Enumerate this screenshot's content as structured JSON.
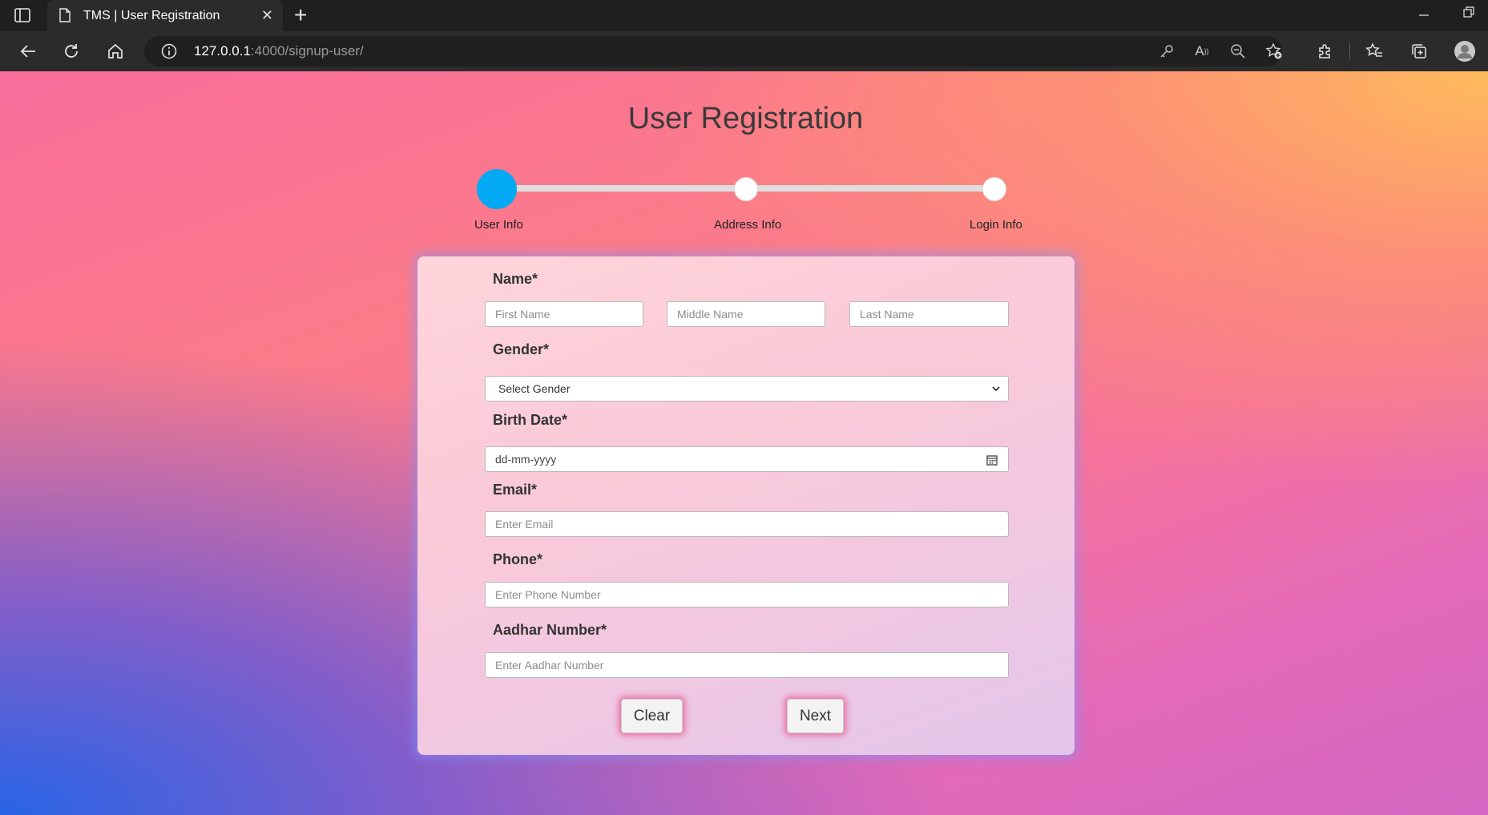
{
  "browser": {
    "tab_title": "TMS | User Registration",
    "url_host": "127.0.0.1",
    "url_rest": ":4000/signup-user/"
  },
  "page": {
    "title": "User Registration"
  },
  "stepper": {
    "steps": [
      {
        "label": "User Info",
        "state": "active"
      },
      {
        "label": "Address Info",
        "state": "pending"
      },
      {
        "label": "Login Info",
        "state": "pending"
      }
    ],
    "active_color": "#03a9f4"
  },
  "form": {
    "name_label": "Name*",
    "first_name_placeholder": "First Name",
    "middle_name_placeholder": "Middle Name",
    "last_name_placeholder": "Last Name",
    "gender_label": "Gender*",
    "gender_selected": "Select Gender",
    "birth_label": "Birth Date*",
    "birth_value": "dd-mm-yyyy",
    "email_label": "Email*",
    "email_placeholder": "Enter Email",
    "phone_label": "Phone*",
    "phone_placeholder": "Enter Phone Number",
    "aadhar_label": "Aadhar Number*",
    "aadhar_placeholder": "Enter Aadhar Number",
    "clear_label": "Clear",
    "next_label": "Next"
  },
  "icons": [
    "sidebar-icon",
    "page-icon",
    "close-icon",
    "plus-icon",
    "minimize-icon",
    "restore-icon",
    "back-icon",
    "refresh-icon",
    "home-icon",
    "info-icon",
    "key-icon",
    "read-aloud-icon",
    "zoom-out-icon",
    "add-favorite-icon",
    "extensions-icon",
    "favorites-icon",
    "collections-icon",
    "profile-icon",
    "chevron-down-icon",
    "calendar-icon"
  ]
}
